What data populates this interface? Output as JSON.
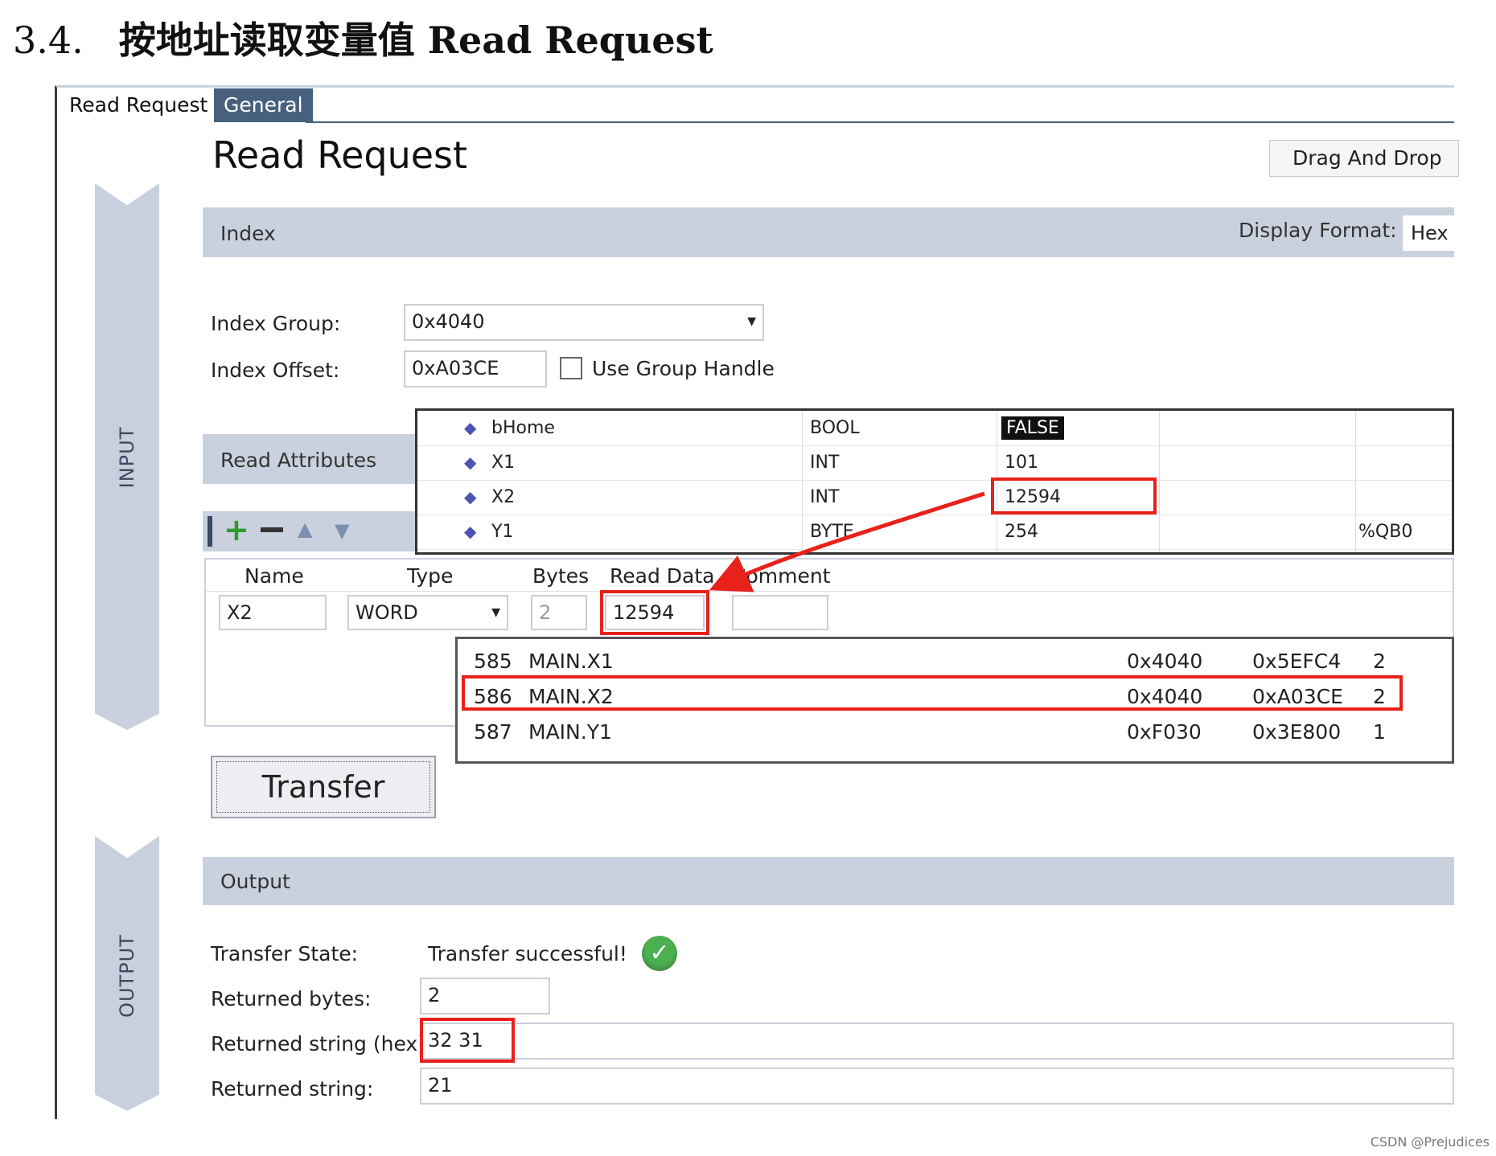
{
  "heading": {
    "number": "3.4.",
    "text": "按地址读取变量值 Read Request"
  },
  "tabs": {
    "active": "Read Request",
    "general": "General"
  },
  "page": {
    "title": "Read Request",
    "drag_drop": "Drag And Drop"
  },
  "side": {
    "input": "INPUT",
    "output": "OUTPUT"
  },
  "index": {
    "section": "Index",
    "display_format_label": "Display Format:",
    "display_format_value": "Hex",
    "group_label": "Index Group:",
    "group_value": "0x4040",
    "offset_label": "Index Offset:",
    "offset_value": "0xA03CE",
    "use_group_handle": "Use Group Handle"
  },
  "attributes": {
    "section": "Read Attributes"
  },
  "popup": {
    "rows": [
      {
        "name": "bHome",
        "type": "BOOL",
        "value": "FALSE",
        "addr": ""
      },
      {
        "name": "X1",
        "type": "INT",
        "value": "101",
        "addr": ""
      },
      {
        "name": "X2",
        "type": "INT",
        "value": "12594",
        "addr": ""
      },
      {
        "name": "Y1",
        "type": "BYTE",
        "value": "254",
        "addr": "%QB0"
      }
    ]
  },
  "grid": {
    "headers": {
      "name": "Name",
      "type": "Type",
      "bytes": "Bytes",
      "read_data": "Read Data",
      "comment": "Comment"
    },
    "row": {
      "name": "X2",
      "type": "WORD",
      "bytes": "2",
      "read_data": "12594",
      "comment": ""
    }
  },
  "symbols": {
    "rows": [
      {
        "id": "585",
        "name": "MAIN.X1",
        "group": "0x4040",
        "offset": "0x5EFC4",
        "size": "2"
      },
      {
        "id": "586",
        "name": "MAIN.X2",
        "group": "0x4040",
        "offset": "0xA03CE",
        "size": "2"
      },
      {
        "id": "587",
        "name": "MAIN.Y1",
        "group": "0xF030",
        "offset": "0x3E800",
        "size": "1"
      }
    ]
  },
  "transfer_button": "Transfer",
  "output": {
    "section": "Output",
    "state_label": "Transfer State:",
    "state_value": "Transfer successful!",
    "bytes_label": "Returned bytes:",
    "bytes_value": "2",
    "hex_label": "Returned string (hex):",
    "hex_value": "32 31",
    "string_label": "Returned string:",
    "string_value": "21"
  },
  "watermark": "CSDN @Prejudices",
  "colors": {
    "band": "#c9d1de",
    "tab_dark": "#47607e",
    "highlight": "#e8211b",
    "success": "#4caf50"
  }
}
